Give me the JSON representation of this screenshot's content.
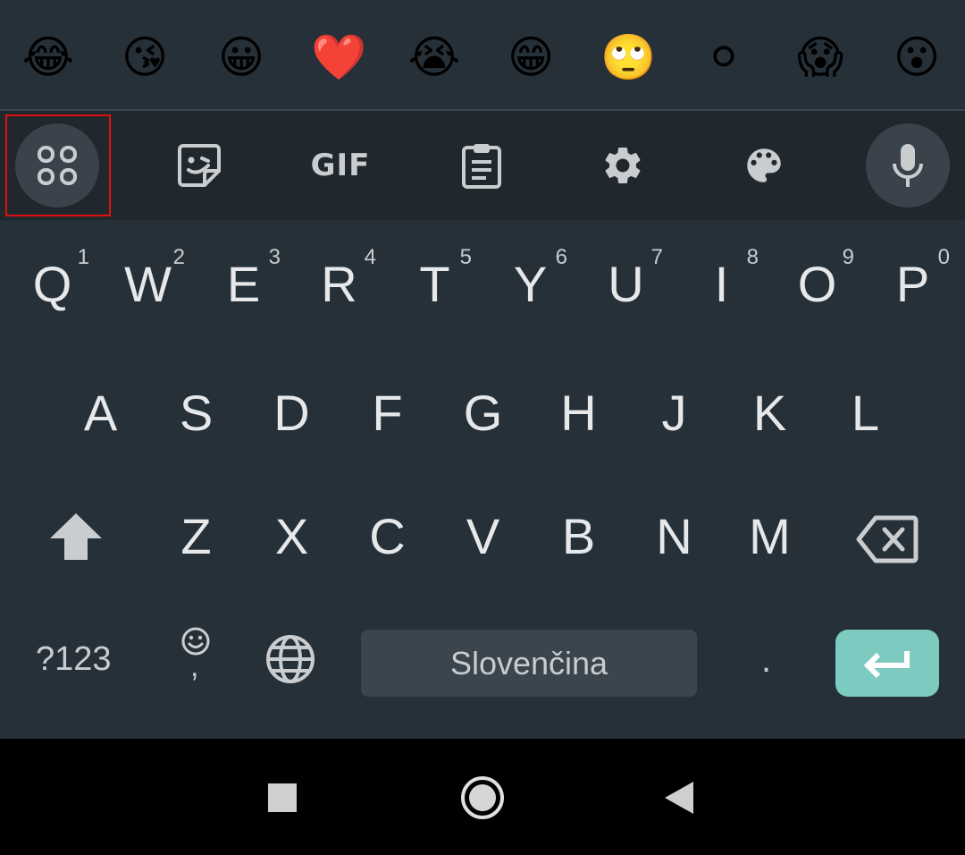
{
  "emoji_suggestions": [
    "😂",
    "😘",
    "😀",
    "❤️",
    "😭",
    "😁",
    "🙄",
    "⚪",
    "😱",
    "😮"
  ],
  "toolbar": {
    "gif_label": "GIF",
    "icons": [
      "apps-grid-icon",
      "sticker-icon",
      "gif-icon",
      "clipboard-icon",
      "settings-gear-icon",
      "palette-icon",
      "microphone-icon"
    ]
  },
  "keyboard": {
    "row1": [
      {
        "letter": "Q",
        "hint": "1"
      },
      {
        "letter": "W",
        "hint": "2"
      },
      {
        "letter": "E",
        "hint": "3"
      },
      {
        "letter": "R",
        "hint": "4"
      },
      {
        "letter": "T",
        "hint": "5"
      },
      {
        "letter": "Y",
        "hint": "6"
      },
      {
        "letter": "U",
        "hint": "7"
      },
      {
        "letter": "I",
        "hint": "8"
      },
      {
        "letter": "O",
        "hint": "9"
      },
      {
        "letter": "P",
        "hint": "0"
      }
    ],
    "row2": [
      "A",
      "S",
      "D",
      "F",
      "G",
      "H",
      "J",
      "K",
      "L"
    ],
    "row3": [
      "Z",
      "X",
      "C",
      "V",
      "B",
      "N",
      "M"
    ],
    "symbols_key": "?123",
    "comma_key": ",",
    "space_label": "Slovenčina",
    "period_key": "."
  },
  "colors": {
    "background": "#263038",
    "toolbar": "#20282e",
    "enter": "#7ccac0",
    "highlight": "#e01010"
  }
}
